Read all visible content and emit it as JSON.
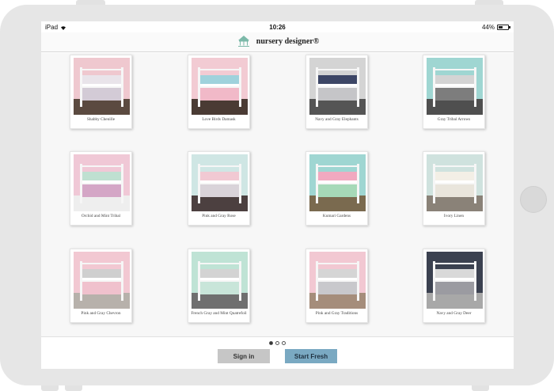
{
  "status": {
    "device": "iPad",
    "time": "10:26",
    "battery": "44%",
    "battery_level": 0.44
  },
  "nav": {
    "title": "nursery designer®"
  },
  "designs": [
    {
      "name": "Shabby Chenille",
      "wall": "#efc8cf",
      "accent": "#e9e4ea",
      "skirt": "#d3cbd6",
      "floor": "#5b4a40"
    },
    {
      "name": "Love Birds Damask",
      "wall": "#f2cbd3",
      "accent": "#9fd2dc",
      "skirt": "#f1b9c8",
      "floor": "#4a3b34"
    },
    {
      "name": "Navy and Gray Elephants",
      "wall": "#d4d4d4",
      "accent": "#3d4666",
      "skirt": "#c5c5c8",
      "floor": "#555"
    },
    {
      "name": "Gray Tribal Arrows",
      "wall": "#9fd6d2",
      "accent": "#d4d4d4",
      "skirt": "#7d7d7d",
      "floor": "#4f4f4f"
    },
    {
      "name": "Orchid and Mint Tribal",
      "wall": "#f0c8d6",
      "accent": "#bfe0d1",
      "skirt": "#d4a6c6",
      "floor": "#eeeeee"
    },
    {
      "name": "Pink and Gray Rose",
      "wall": "#cfe6e4",
      "accent": "#f1c9d3",
      "skirt": "#d9d3d9",
      "floor": "#4c4040"
    },
    {
      "name": "Kumari Gardens",
      "wall": "#9fd6d2",
      "accent": "#f1a9c0",
      "skirt": "#a6d9b8",
      "floor": "#7a6a4f"
    },
    {
      "name": "Ivory Linen",
      "wall": "#cfe2de",
      "accent": "#f3efe6",
      "skirt": "#e9e5dc",
      "floor": "#8a8278"
    },
    {
      "name": "Pink and Gray Chevron",
      "wall": "#f2c8d2",
      "accent": "#cfcfcf",
      "skirt": "#f0c1cd",
      "floor": "#b7b1ab"
    },
    {
      "name": "French Gray and Mint Quatrefoil",
      "wall": "#bfe3d5",
      "accent": "#d3d3d3",
      "skirt": "#c8e5d9",
      "floor": "#6f6f6f"
    },
    {
      "name": "Pink and Gray Traditions",
      "wall": "#f2c8d2",
      "accent": "#d5d5d5",
      "skirt": "#c8c8cc",
      "floor": "#a58d7b"
    },
    {
      "name": "Navy and Gray Deer",
      "wall": "#3b4150",
      "accent": "#d9d9d9",
      "skirt": "#9b9ba1",
      "floor": "#a8a8a8"
    }
  ],
  "pagination": {
    "pages": 3,
    "current": 1
  },
  "actions": {
    "signin_label": "Sign in",
    "fresh_label": "Start Fresh"
  }
}
